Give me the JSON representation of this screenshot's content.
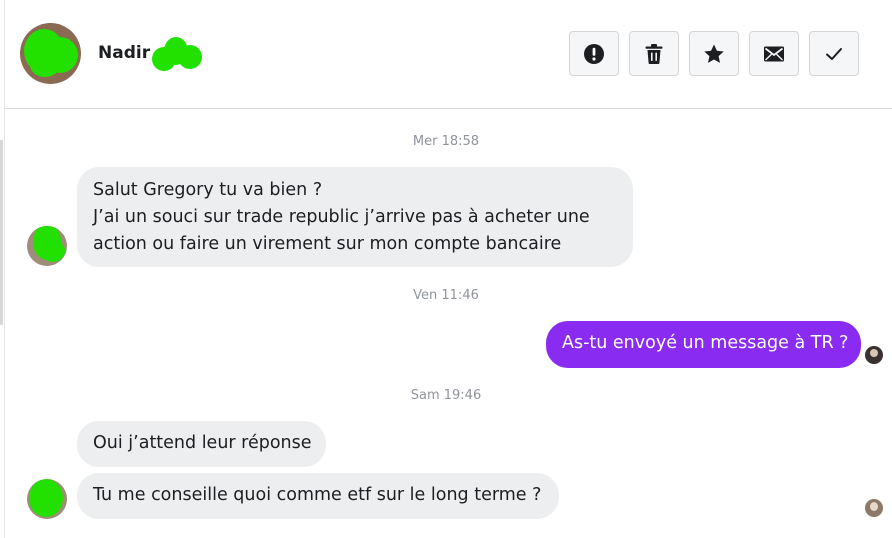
{
  "contact": {
    "name": "Nadir"
  },
  "toolbar": {
    "report_icon": "exclamation-circle-icon",
    "delete_icon": "trash-icon",
    "star_icon": "star-icon",
    "mail_icon": "envelope-icon",
    "done_icon": "check-icon"
  },
  "messages": {
    "t1": "Mer 18:58",
    "m1_line1": "Salut Gregory tu va bien ?",
    "m1_line2": "J’ai un souci sur trade republic j’arrive pas à acheter une",
    "m1_line3": "action ou faire un virement sur mon compte bancaire",
    "t2": "Ven 11:46",
    "m2": "As-tu envoyé un message à TR ?",
    "t3": "Sam 19:46",
    "m3": "Oui j’attend leur réponse",
    "m4": "Tu me conseille quoi comme etf sur le long terme ?"
  },
  "colors": {
    "outgoing_bubble": "#8a2bf2",
    "incoming_bubble": "#eceef0",
    "redaction": "#22e000"
  }
}
